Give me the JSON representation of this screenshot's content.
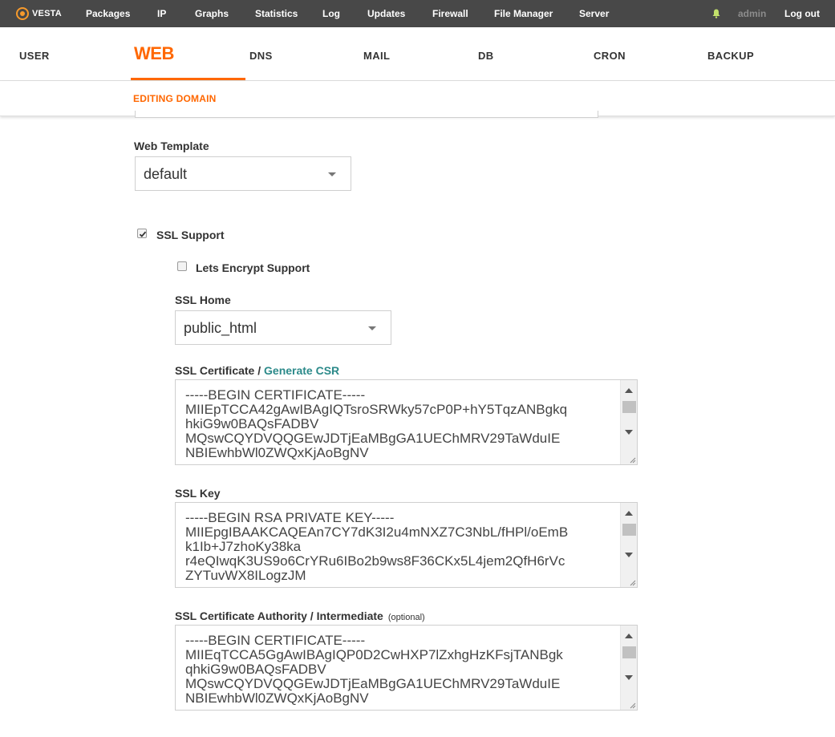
{
  "topbar": {
    "brand": "VESTA",
    "nav": [
      "Packages",
      "IP",
      "Graphs",
      "Statistics",
      "Log",
      "Updates",
      "Firewall",
      "File Manager",
      "Server"
    ],
    "user": "admin",
    "logout": "Log out",
    "bell_icon": "bell-icon",
    "accent": "#ff6701"
  },
  "tabs": {
    "user": "USER",
    "web": "WEB",
    "dns": "DNS",
    "mail": "MAIL",
    "db": "DB",
    "cron": "CRON",
    "backup": "BACKUP",
    "active": "WEB"
  },
  "subheader": {
    "title": "EDITING DOMAIN"
  },
  "form": {
    "web_template": {
      "label": "Web Template",
      "value": "default"
    },
    "ssl_support": {
      "label": "SSL Support",
      "checked": true
    },
    "lets_encrypt": {
      "label": "Lets Encrypt Support",
      "checked": false
    },
    "ssl_home": {
      "label": "SSL Home",
      "value": "public_html"
    },
    "ssl_certificate": {
      "label": "SSL Certificate /",
      "link": "Generate CSR",
      "value": "-----BEGIN CERTIFICATE-----\nMIIEpTCCA42gAwIBAgIQTsroSRWky57cP0P+hY5TqzANBgkq\nhkiG9w0BAQsFADBV\nMQswCQYDVQQGEwJDTjEaMBgGA1UEChMRV29TaWduIE\nNBIEwhbWl0ZWQxKjAoBgNV"
    },
    "ssl_key": {
      "label": "SSL Key",
      "value": "-----BEGIN RSA PRIVATE KEY-----\nMIIEpgIBAAKCAQEAn7CY7dK3I2u4mNXZ7C3NbL/fHPl/oEmB\nk1Ib+J7zhoKy38ka\nr4eQIwqK3US9o6CrYRu6IBo2b9ws8F36CKx5L4jem2QfH6rVc\nZYTuvWX8ILogzJM"
    },
    "ssl_ca": {
      "label": "SSL Certificate Authority / Intermediate",
      "optional": "(optional)",
      "value": "-----BEGIN CERTIFICATE-----\nMIIEqTCCA5GgAwIBAgIQP0D2CwHXP7lZxhgHzKFsjTANBgk\nqhkiG9w0BAQsFADBV\nMQswCQYDVQQGEwJDTjEaMBgGA1UEChMRV29TaWduIE\nNBIEwhbWl0ZWQxKjAoBgNV"
    }
  }
}
